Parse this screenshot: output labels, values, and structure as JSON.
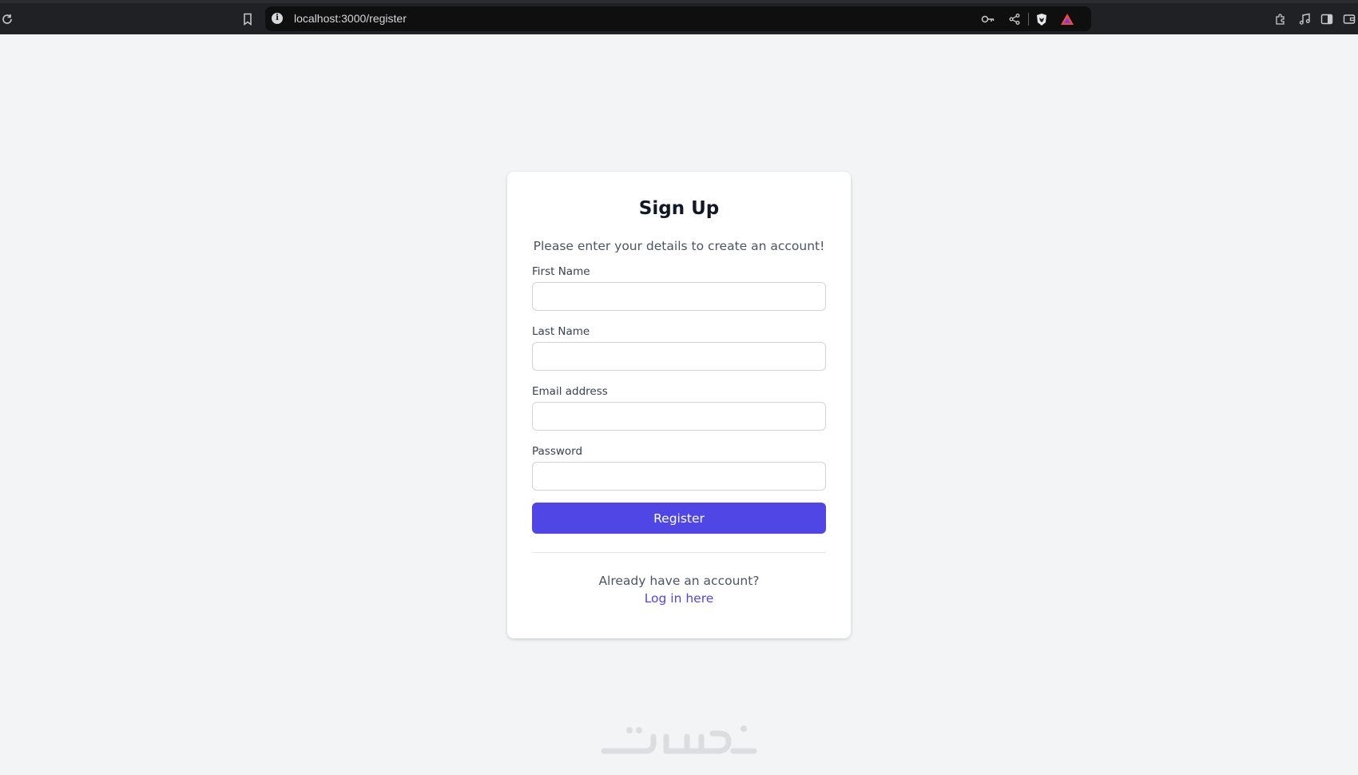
{
  "browser": {
    "url": "localhost:3000/register",
    "icons": [
      "reload-icon",
      "bookmark-icon",
      "site-info-icon",
      "password-key-icon",
      "share-icon",
      "brave-shield-icon",
      "brave-rewards-icon",
      "extensions-icon",
      "media-icon",
      "sidebar-icon",
      "wallet-icon"
    ]
  },
  "form": {
    "title": "Sign Up",
    "subtitle": "Please enter your details to create an account!",
    "fields": [
      {
        "label": "First Name",
        "value": "",
        "type": "text"
      },
      {
        "label": "Last Name",
        "value": "",
        "type": "text"
      },
      {
        "label": "Email address",
        "value": "",
        "type": "email"
      },
      {
        "label": "Password",
        "value": "",
        "type": "password"
      }
    ],
    "submit_label": "Register",
    "footer_text": "Already have an account?",
    "login_link": "Log in here"
  },
  "colors": {
    "accent": "#4f46e5",
    "background": "#f3f4f6",
    "card": "#ffffff"
  },
  "watermark": "خمسات"
}
